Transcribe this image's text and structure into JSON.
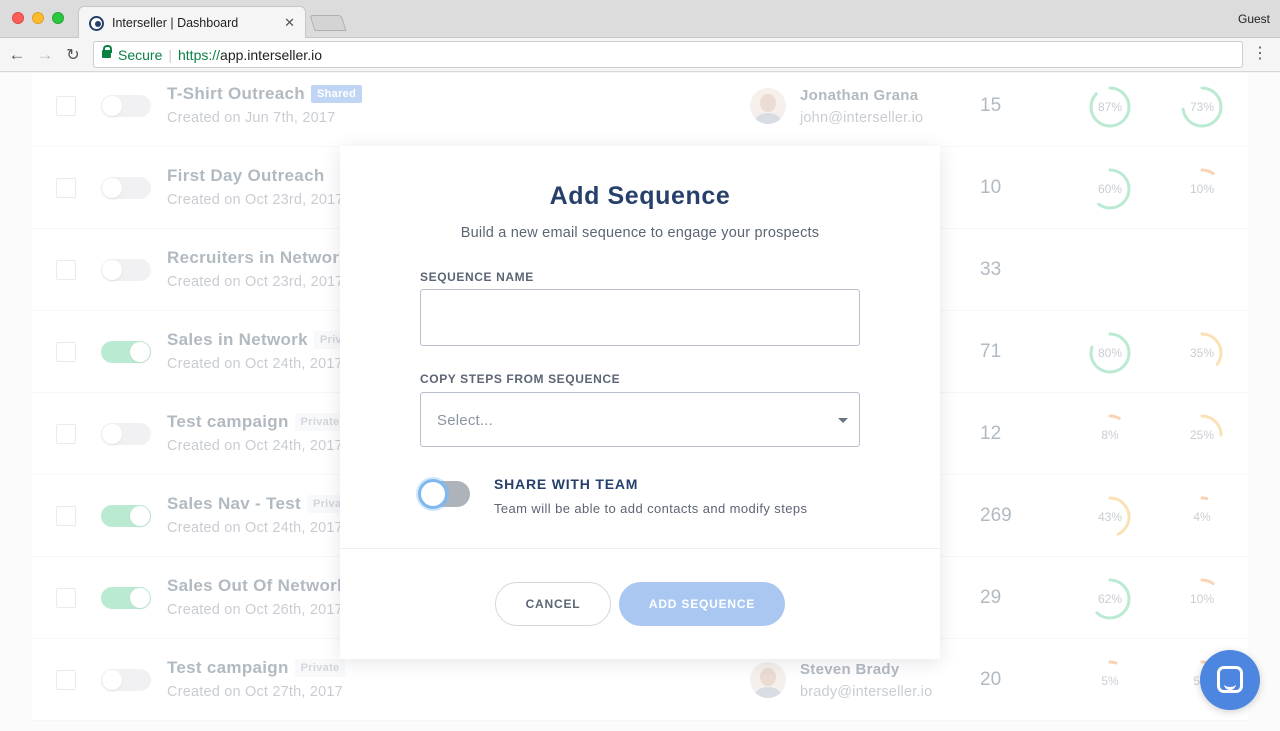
{
  "browser": {
    "tab_title": "Interseller | Dashboard",
    "tab_close": "✕",
    "profile": "Guest",
    "secure_label": "Secure",
    "url_scheme": "https://",
    "url_host": "app.interseller.io"
  },
  "rows": [
    {
      "name": "T-Shirt Outreach",
      "badge": "Shared",
      "date": "Created on Jun 7th, 2017",
      "owner": "Jonathan Grana",
      "email": "john@interseller.io",
      "count": "15",
      "metric1": "87%",
      "metric2": "73%",
      "enabled": false
    },
    {
      "name": "First Day Outreach",
      "badge": "",
      "date": "Created on Oct 23rd, 2017",
      "owner": "",
      "email": "",
      "count": "10",
      "metric1": "60%",
      "metric2": "10%",
      "enabled": false
    },
    {
      "name": "Recruiters in Network",
      "badge": "",
      "date": "Created on Oct 23rd, 2017",
      "owner": "",
      "email": "",
      "count": "33",
      "metric1": "",
      "metric2": "",
      "enabled": false
    },
    {
      "name": "Sales in Network",
      "badge": "Private",
      "date": "Created on Oct 24th, 2017",
      "owner": "",
      "email": "",
      "count": "71",
      "metric1": "80%",
      "metric2": "35%",
      "enabled": true
    },
    {
      "name": "Test campaign",
      "badge": "Private",
      "date": "Created on Oct 24th, 2017",
      "owner": "",
      "email": "",
      "count": "12",
      "metric1": "8%",
      "metric2": "25%",
      "enabled": false
    },
    {
      "name": "Sales Nav - Test",
      "badge": "Private",
      "date": "Created on Oct 24th, 2017",
      "owner": "",
      "email": "",
      "count": "269",
      "metric1": "43%",
      "metric2": "4%",
      "enabled": true
    },
    {
      "name": "Sales Out Of Network",
      "badge": "",
      "date": "Created on Oct 26th, 2017",
      "owner": "",
      "email": "",
      "count": "29",
      "metric1": "62%",
      "metric2": "10%",
      "enabled": true
    },
    {
      "name": "Test campaign",
      "badge": "Private",
      "date": "Created on Oct 27th, 2017",
      "owner": "Steven Brady",
      "email": "brady@interseller.io",
      "count": "20",
      "metric1": "5%",
      "metric2": "5%",
      "enabled": false
    }
  ],
  "modal": {
    "title": "Add Sequence",
    "subtitle": "Build a new email sequence to engage your prospects",
    "name_label": "SEQUENCE NAME",
    "name_value": "",
    "copy_label": "COPY STEPS FROM SEQUENCE",
    "copy_placeholder": "Select...",
    "share_title": "SHARE WITH TEAM",
    "share_desc": "Team will be able to add contacts and modify steps",
    "share_enabled": false,
    "cancel_label": "CANCEL",
    "submit_label": "ADD SEQUENCE"
  },
  "colors": {
    "brand_navy": "#26406b",
    "accent_blue": "#4d86e0",
    "toggle_on": "#4cc98a",
    "ring_green": "#4cc98a",
    "ring_yellow": "#f2b441",
    "ring_orange": "#ee8c3a"
  }
}
